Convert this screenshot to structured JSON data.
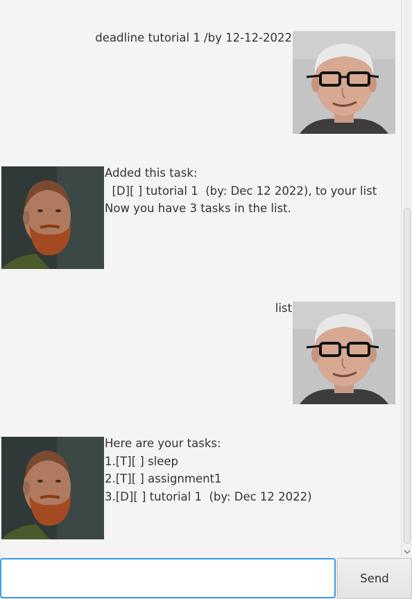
{
  "messages": [
    {
      "sender": "user",
      "text": "deadline tutorial 1 /by 12-12-2022",
      "avatar": "user-avatar"
    },
    {
      "sender": "bot",
      "text": "Added this task:\n  [D][ ] tutorial 1  (by: Dec 12 2022), to your list\nNow you have 3 tasks in the list.",
      "avatar": "bot-avatar"
    },
    {
      "sender": "user",
      "text": "list",
      "avatar": "user-avatar"
    },
    {
      "sender": "bot",
      "text": "Here are your tasks:\n1.[T][ ] sleep\n2.[T][ ] assignment1\n3.[D][ ] tutorial 1  (by: Dec 12 2022)",
      "avatar": "bot-avatar"
    }
  ],
  "input": {
    "value": "",
    "placeholder": ""
  },
  "send_button": {
    "label": "Send"
  },
  "scrollbar": {
    "position_fraction": 1.0,
    "down_arrow_icon": "chevron-down-icon"
  },
  "colors": {
    "background": "#f4f4f4",
    "input_focus_border": "#3c9ee0",
    "text": "#333333"
  }
}
